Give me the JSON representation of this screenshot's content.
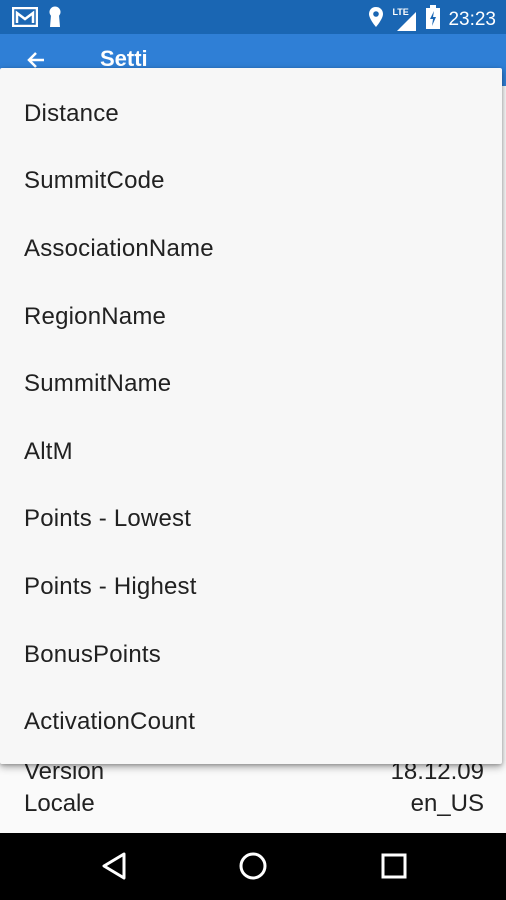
{
  "status_bar": {
    "time": "23:23",
    "network": "LTE",
    "icons": [
      "mail-icon",
      "keyhole-icon",
      "location-icon",
      "signal-icon",
      "battery-icon"
    ]
  },
  "app_bar": {
    "title": "Setti"
  },
  "menu": {
    "items": [
      "Distance",
      "SummitCode",
      "AssociationName",
      "RegionName",
      "SummitName",
      "AltM",
      "Points - Lowest",
      "Points - Highest",
      "BonusPoints",
      "ActivationCount"
    ]
  },
  "info": {
    "version_label": "Version",
    "version_value": "18.12.09",
    "locale_label": "Locale",
    "locale_value": "en_US"
  },
  "nav": {
    "icons": [
      "back-icon",
      "home-icon",
      "recents-icon"
    ]
  },
  "colors": {
    "status_bar": "#1a66b3",
    "app_bar": "#2f7fd6"
  }
}
